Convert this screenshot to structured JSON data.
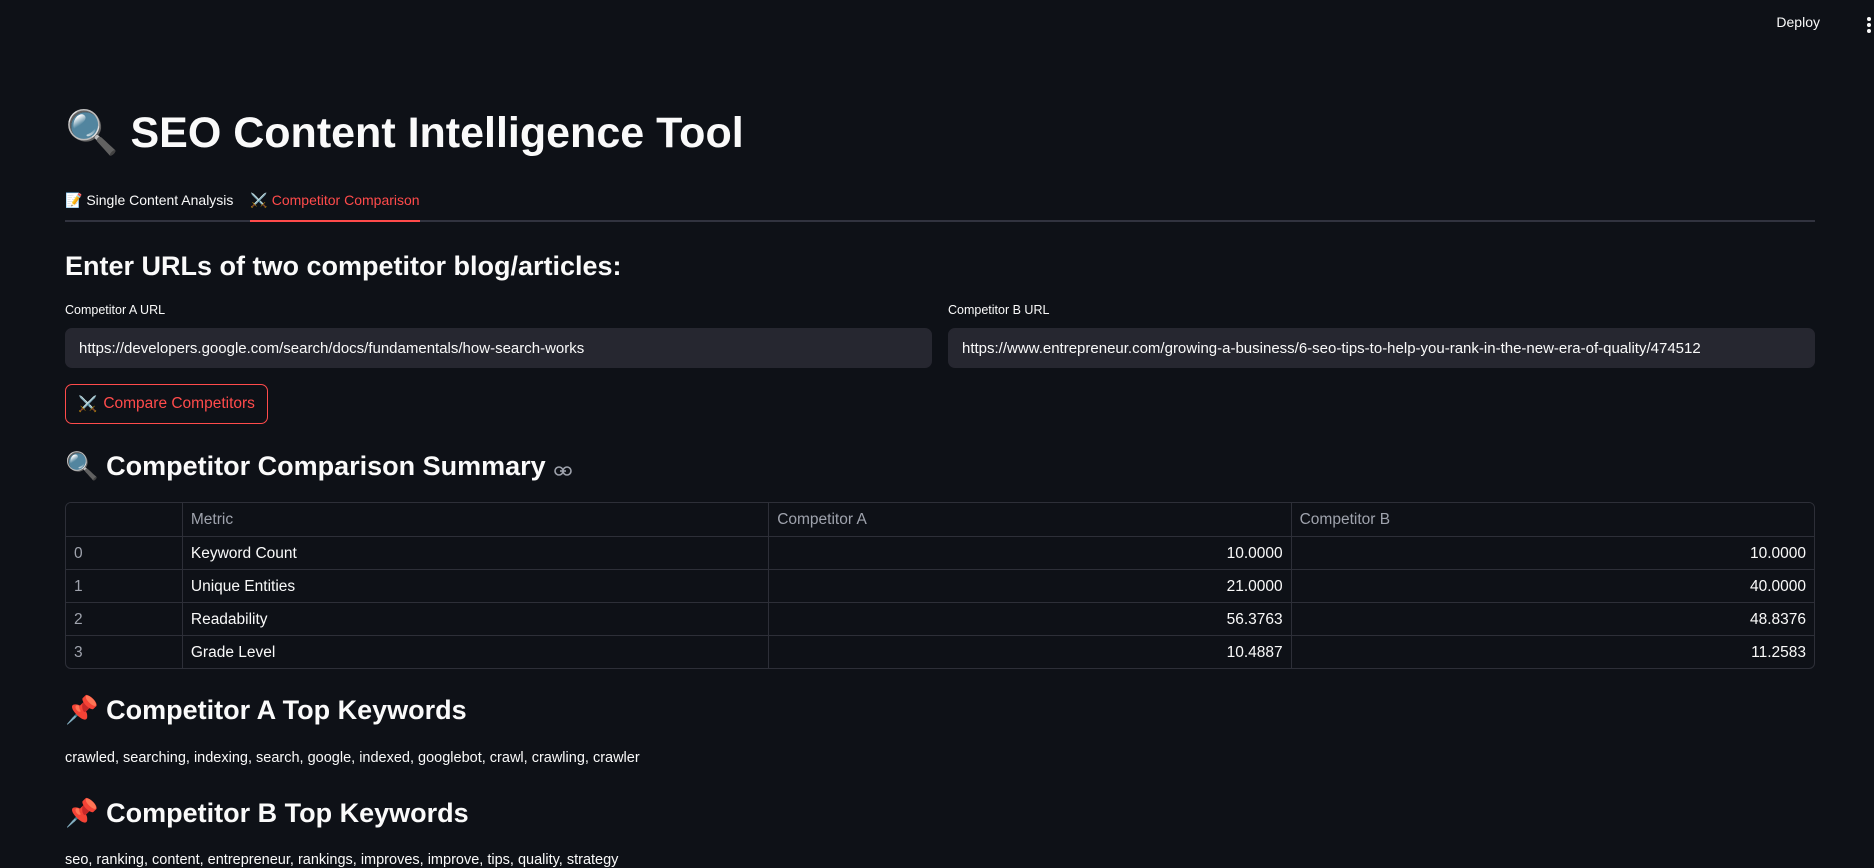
{
  "header": {
    "deploy_label": "Deploy"
  },
  "app": {
    "title": "🔍 SEO Content Intelligence Tool"
  },
  "tabs": [
    {
      "label": "📝 Single Content Analysis",
      "active": false
    },
    {
      "label": "⚔️ Competitor Comparison",
      "active": true
    }
  ],
  "form": {
    "heading": "Enter URLs of two competitor blog/articles:",
    "competitor_a": {
      "label": "Competitor A URL",
      "value": "https://developers.google.com/search/docs/fundamentals/how-search-works"
    },
    "competitor_b": {
      "label": "Competitor B URL",
      "value": "https://www.entrepreneur.com/growing-a-business/6-seo-tips-to-help-you-rank-in-the-new-era-of-quality/474512"
    },
    "compare_button_icon": "⚔️",
    "compare_button_label": "Compare Competitors"
  },
  "summary": {
    "heading": "🔍 Competitor Comparison Summary",
    "columns": [
      "",
      "Metric",
      "Competitor A",
      "Competitor B"
    ],
    "rows": [
      {
        "index": "0",
        "metric": "Keyword Count",
        "a": "10.0000",
        "b": "10.0000"
      },
      {
        "index": "1",
        "metric": "Unique Entities",
        "a": "21.0000",
        "b": "40.0000"
      },
      {
        "index": "2",
        "metric": "Readability",
        "a": "56.3763",
        "b": "48.8376"
      },
      {
        "index": "3",
        "metric": "Grade Level",
        "a": "10.4887",
        "b": "11.2583"
      }
    ]
  },
  "keywords": {
    "a_heading": "📌 Competitor A Top Keywords",
    "a_list": "crawled, searching, indexing, search, google, indexed, googlebot, crawl, crawling, crawler",
    "b_heading": "📌 Competitor B Top Keywords",
    "b_list": "seo, ranking, content, entrepreneur, rankings, improves, improve, tips, quality, strategy"
  },
  "colors": {
    "background": "#0e1117",
    "accent": "#ff4b4b",
    "input_bg": "#262730",
    "border": "#2d2f38",
    "muted_text": "#9fa3ad"
  }
}
